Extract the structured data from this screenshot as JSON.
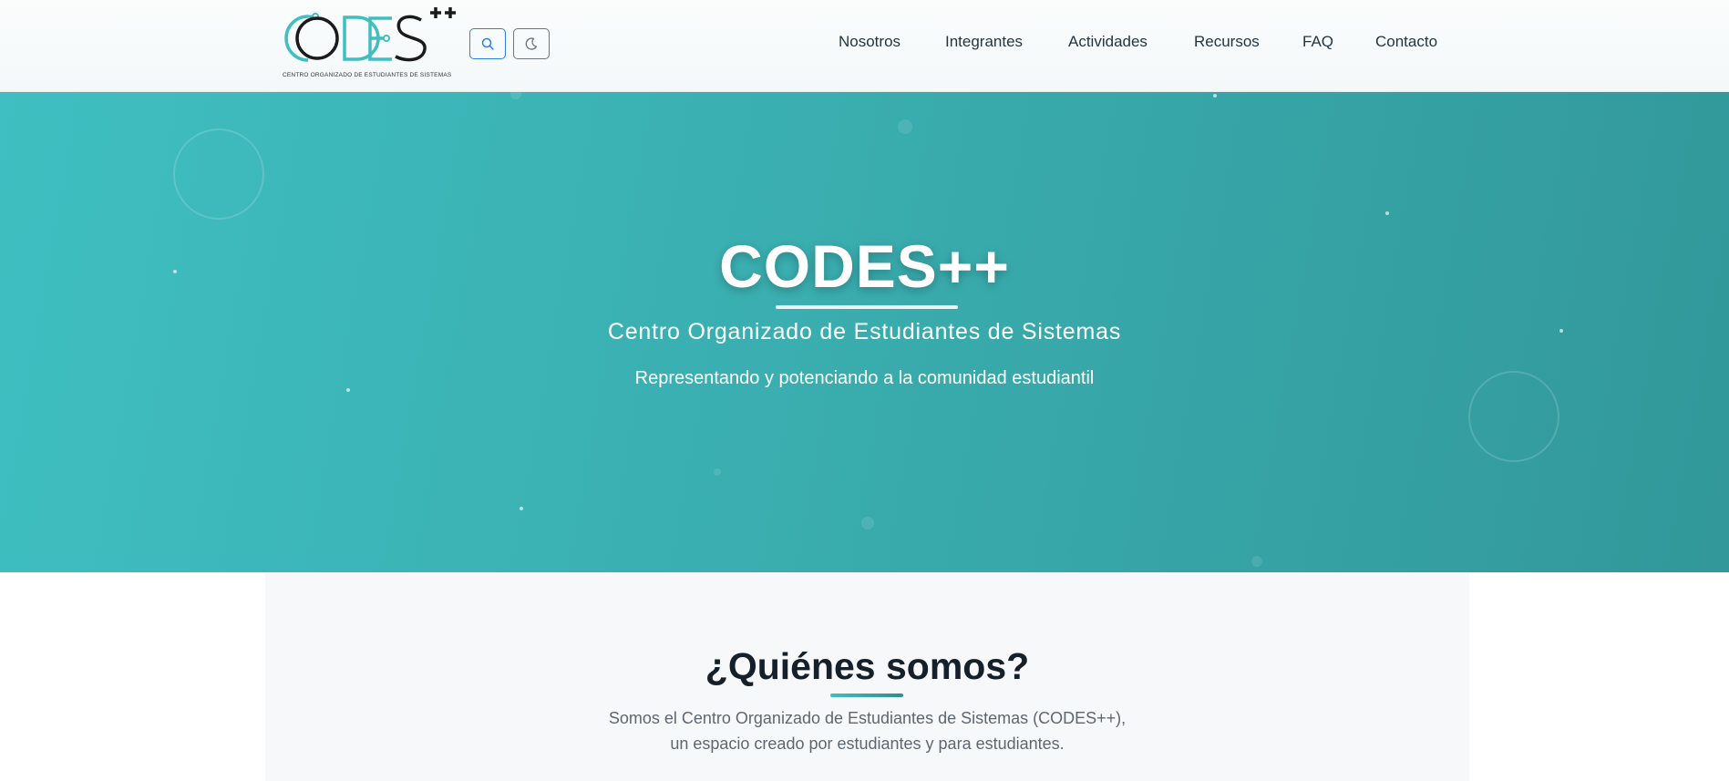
{
  "brand": {
    "logo_text": "CODES",
    "logo_suffix": "++",
    "logo_tagline": "CENTRO ORGANIZADO DE ESTUDIANTES DE SISTEMAS",
    "colors": {
      "teal": "#3fbfc1",
      "dark": "#1b1b1b"
    }
  },
  "toolbar": {
    "search_icon": "search-icon",
    "theme_icon": "moon-icon"
  },
  "nav": {
    "items": [
      {
        "label": "Nosotros"
      },
      {
        "label": "Integrantes"
      },
      {
        "label": "Actividades"
      },
      {
        "label": "Recursos"
      },
      {
        "label": "FAQ"
      },
      {
        "label": "Contacto"
      }
    ]
  },
  "hero": {
    "title": "CODES++",
    "subtitle": "Centro Organizado de Estudiantes de Sistemas",
    "tagline": "Representando y potenciando a la comunidad estudiantil",
    "colors": {
      "start": "#3fbfc1",
      "end": "#32989a"
    }
  },
  "about": {
    "title": "¿Quiénes somos?",
    "line1": "Somos el Centro Organizado de Estudiantes de Sistemas (CODES++),",
    "line2": "un espacio creado por estudiantes y para estudiantes."
  }
}
